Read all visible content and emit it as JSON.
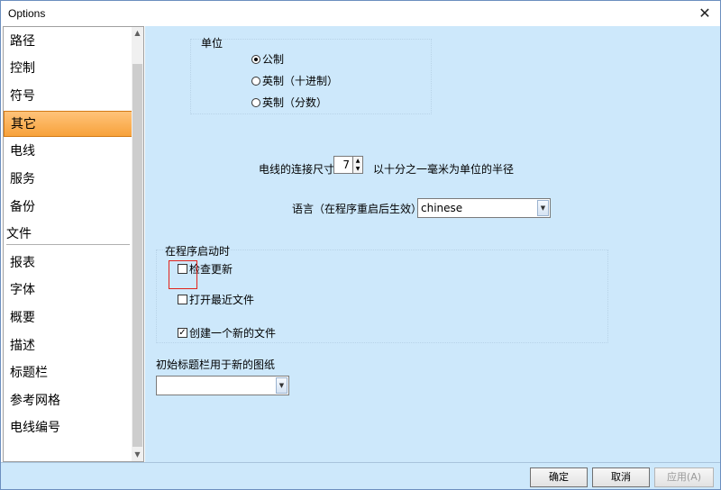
{
  "window": {
    "title": "Options",
    "close_glyph": "✕"
  },
  "sidebar": {
    "items": [
      {
        "label": "路径"
      },
      {
        "label": "控制"
      },
      {
        "label": "符号"
      },
      {
        "label": "其它"
      },
      {
        "label": "电线"
      },
      {
        "label": "服务"
      },
      {
        "label": "备份"
      }
    ],
    "group_label": "文件",
    "items2": [
      {
        "label": "报表"
      },
      {
        "label": "字体"
      },
      {
        "label": "概要"
      },
      {
        "label": "描述"
      },
      {
        "label": "标题栏"
      },
      {
        "label": "参考网格"
      },
      {
        "label": "电线编号"
      }
    ],
    "selected": "其它"
  },
  "units": {
    "title": "单位",
    "options": [
      "公制",
      "英制（十进制）",
      "英制（分数）"
    ],
    "selected": "公制"
  },
  "wire": {
    "label": "电线的连接尺寸",
    "value": "7",
    "suffix": "以十分之一毫米为单位的半径"
  },
  "language": {
    "label": "语言（在程序重启后生效）",
    "value": "chinese"
  },
  "startup": {
    "title": "在程序启动时",
    "options": [
      {
        "label": "检查更新",
        "checked": false
      },
      {
        "label": "打开最近文件",
        "checked": false
      },
      {
        "label": "创建一个新的文件",
        "checked": true
      }
    ]
  },
  "titleblock": {
    "label": "初始标题栏用于新的图纸",
    "value": ""
  },
  "footer": {
    "ok": "确定",
    "cancel": "取消",
    "apply": "应用(A)"
  },
  "colors": {
    "panel": "#cde8fb",
    "selected_item": "#f7a23b",
    "highlight": "#e2231a"
  }
}
